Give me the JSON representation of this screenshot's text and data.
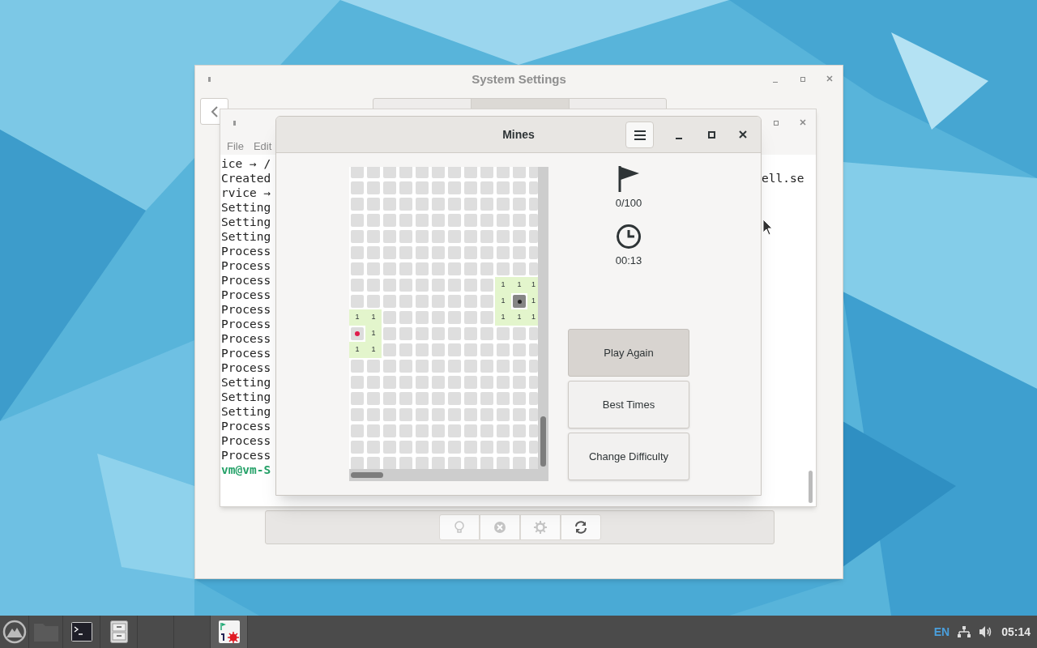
{
  "settings_window": {
    "title": "System Settings",
    "toolbar": [
      {
        "kind": "bulb",
        "disabled": true
      },
      {
        "kind": "cancel",
        "disabled": true
      },
      {
        "kind": "gear",
        "disabled": true
      },
      {
        "kind": "refresh",
        "disabled": false
      }
    ]
  },
  "terminal_window": {
    "menu": [
      "File",
      "Edit"
    ],
    "lines": [
      {
        "text": "ice → /",
        "kind": "output"
      },
      {
        "text": "Created",
        "kind": "output"
      },
      {
        "text": "rvice →",
        "kind": "output"
      },
      {
        "text": "Setting",
        "kind": "output"
      },
      {
        "text": "Setting",
        "kind": "output"
      },
      {
        "text": "Setting",
        "kind": "output"
      },
      {
        "text": "Process",
        "kind": "output"
      },
      {
        "text": "Process",
        "kind": "output"
      },
      {
        "text": "Process",
        "kind": "output"
      },
      {
        "text": "Process",
        "kind": "output"
      },
      {
        "text": "Process",
        "kind": "output"
      },
      {
        "text": "Process",
        "kind": "output"
      },
      {
        "text": "Process",
        "kind": "output"
      },
      {
        "text": "Process",
        "kind": "output"
      },
      {
        "text": "Process",
        "kind": "output"
      },
      {
        "text": "Setting",
        "kind": "output"
      },
      {
        "text": "Setting",
        "kind": "output"
      },
      {
        "text": "Setting",
        "kind": "output"
      },
      {
        "text": "Process",
        "kind": "output"
      },
      {
        "text": "Process",
        "kind": "output"
      },
      {
        "text": "Process",
        "kind": "output"
      },
      {
        "text": "vm@vm-S",
        "kind": "prompt"
      }
    ],
    "right_fragment": "ell.se"
  },
  "mines_window": {
    "title": "Mines",
    "flags": "0/100",
    "time": "00:13",
    "buttons": [
      {
        "label": "Play Again",
        "selected": true
      },
      {
        "label": "Best Times",
        "selected": false
      },
      {
        "label": "Change Difficulty",
        "selected": false
      }
    ],
    "board": {
      "rows": [
        {
          "cells": [
            {
              "kind": "hidden"
            },
            {
              "kind": "hidden"
            },
            {
              "kind": "hidden"
            },
            {
              "kind": "hidden"
            },
            {
              "kind": "hidden"
            },
            {
              "kind": "hidden"
            },
            {
              "kind": "hidden"
            },
            {
              "kind": "hidden"
            },
            {
              "kind": "hidden"
            },
            {
              "kind": "hidden"
            },
            {
              "kind": "hidden"
            },
            {
              "kind": "hidden"
            }
          ]
        },
        {
          "cells": [
            {
              "kind": "hidden"
            },
            {
              "kind": "hidden"
            },
            {
              "kind": "hidden"
            },
            {
              "kind": "hidden"
            },
            {
              "kind": "hidden"
            },
            {
              "kind": "hidden"
            },
            {
              "kind": "hidden"
            },
            {
              "kind": "hidden"
            },
            {
              "kind": "hidden"
            },
            {
              "kind": "hidden"
            },
            {
              "kind": "hidden"
            },
            {
              "kind": "hidden"
            }
          ]
        },
        {
          "cells": [
            {
              "kind": "hidden"
            },
            {
              "kind": "hidden"
            },
            {
              "kind": "hidden"
            },
            {
              "kind": "hidden"
            },
            {
              "kind": "hidden"
            },
            {
              "kind": "hidden"
            },
            {
              "kind": "hidden"
            },
            {
              "kind": "hidden"
            },
            {
              "kind": "hidden"
            },
            {
              "kind": "hidden"
            },
            {
              "kind": "hidden"
            },
            {
              "kind": "hidden"
            }
          ]
        },
        {
          "cells": [
            {
              "kind": "hidden"
            },
            {
              "kind": "hidden"
            },
            {
              "kind": "hidden"
            },
            {
              "kind": "hidden"
            },
            {
              "kind": "hidden"
            },
            {
              "kind": "hidden"
            },
            {
              "kind": "hidden"
            },
            {
              "kind": "hidden"
            },
            {
              "kind": "hidden"
            },
            {
              "kind": "hidden"
            },
            {
              "kind": "hidden"
            },
            {
              "kind": "hidden"
            }
          ]
        },
        {
          "cells": [
            {
              "kind": "hidden"
            },
            {
              "kind": "hidden"
            },
            {
              "kind": "hidden"
            },
            {
              "kind": "hidden"
            },
            {
              "kind": "hidden"
            },
            {
              "kind": "hidden"
            },
            {
              "kind": "hidden"
            },
            {
              "kind": "hidden"
            },
            {
              "kind": "hidden"
            },
            {
              "kind": "hidden"
            },
            {
              "kind": "hidden"
            },
            {
              "kind": "hidden"
            }
          ]
        },
        {
          "cells": [
            {
              "kind": "hidden"
            },
            {
              "kind": "hidden"
            },
            {
              "kind": "hidden"
            },
            {
              "kind": "hidden"
            },
            {
              "kind": "hidden"
            },
            {
              "kind": "hidden"
            },
            {
              "kind": "hidden"
            },
            {
              "kind": "hidden"
            },
            {
              "kind": "hidden"
            },
            {
              "kind": "hidden"
            },
            {
              "kind": "hidden"
            },
            {
              "kind": "hidden"
            }
          ]
        },
        {
          "cells": [
            {
              "kind": "hidden"
            },
            {
              "kind": "hidden"
            },
            {
              "kind": "hidden"
            },
            {
              "kind": "hidden"
            },
            {
              "kind": "hidden"
            },
            {
              "kind": "hidden"
            },
            {
              "kind": "hidden"
            },
            {
              "kind": "hidden"
            },
            {
              "kind": "hidden"
            },
            {
              "kind": "hidden"
            },
            {
              "kind": "hidden"
            },
            {
              "kind": "hidden"
            }
          ]
        },
        {
          "cells": [
            {
              "kind": "hidden"
            },
            {
              "kind": "hidden"
            },
            {
              "kind": "hidden"
            },
            {
              "kind": "hidden"
            },
            {
              "kind": "hidden"
            },
            {
              "kind": "hidden"
            },
            {
              "kind": "hidden"
            },
            {
              "kind": "hidden"
            },
            {
              "kind": "hidden"
            },
            {
              "kind": "number",
              "label": "1"
            },
            {
              "kind": "number",
              "label": "1"
            },
            {
              "kind": "number",
              "label": "1"
            }
          ]
        },
        {
          "cells": [
            {
              "kind": "hidden"
            },
            {
              "kind": "hidden"
            },
            {
              "kind": "hidden"
            },
            {
              "kind": "hidden"
            },
            {
              "kind": "hidden"
            },
            {
              "kind": "hidden"
            },
            {
              "kind": "hidden"
            },
            {
              "kind": "hidden"
            },
            {
              "kind": "hidden"
            },
            {
              "kind": "number",
              "label": "1"
            },
            {
              "kind": "exploded"
            },
            {
              "kind": "number",
              "label": "1"
            }
          ]
        },
        {
          "cells": [
            {
              "kind": "number",
              "label": "1"
            },
            {
              "kind": "number",
              "label": "1"
            },
            {
              "kind": "hidden"
            },
            {
              "kind": "hidden"
            },
            {
              "kind": "hidden"
            },
            {
              "kind": "hidden"
            },
            {
              "kind": "hidden"
            },
            {
              "kind": "hidden"
            },
            {
              "kind": "hidden"
            },
            {
              "kind": "number",
              "label": "1"
            },
            {
              "kind": "number",
              "label": "1"
            },
            {
              "kind": "number",
              "label": "1"
            }
          ]
        },
        {
          "cells": [
            {
              "kind": "mine"
            },
            {
              "kind": "number",
              "label": "1"
            },
            {
              "kind": "hidden"
            },
            {
              "kind": "hidden"
            },
            {
              "kind": "hidden"
            },
            {
              "kind": "hidden"
            },
            {
              "kind": "hidden"
            },
            {
              "kind": "hidden"
            },
            {
              "kind": "hidden"
            },
            {
              "kind": "hidden"
            },
            {
              "kind": "hidden"
            },
            {
              "kind": "hidden"
            }
          ]
        },
        {
          "cells": [
            {
              "kind": "number",
              "label": "1"
            },
            {
              "kind": "number",
              "label": "1"
            },
            {
              "kind": "hidden"
            },
            {
              "kind": "hidden"
            },
            {
              "kind": "hidden"
            },
            {
              "kind": "hidden"
            },
            {
              "kind": "hidden"
            },
            {
              "kind": "hidden"
            },
            {
              "kind": "hidden"
            },
            {
              "kind": "hidden"
            },
            {
              "kind": "hidden"
            },
            {
              "kind": "hidden"
            }
          ]
        },
        {
          "cells": [
            {
              "kind": "hidden"
            },
            {
              "kind": "hidden"
            },
            {
              "kind": "hidden"
            },
            {
              "kind": "hidden"
            },
            {
              "kind": "hidden"
            },
            {
              "kind": "hidden"
            },
            {
              "kind": "hidden"
            },
            {
              "kind": "hidden"
            },
            {
              "kind": "hidden"
            },
            {
              "kind": "hidden"
            },
            {
              "kind": "hidden"
            },
            {
              "kind": "hidden"
            }
          ]
        },
        {
          "cells": [
            {
              "kind": "hidden"
            },
            {
              "kind": "hidden"
            },
            {
              "kind": "hidden"
            },
            {
              "kind": "hidden"
            },
            {
              "kind": "hidden"
            },
            {
              "kind": "hidden"
            },
            {
              "kind": "hidden"
            },
            {
              "kind": "hidden"
            },
            {
              "kind": "hidden"
            },
            {
              "kind": "hidden"
            },
            {
              "kind": "hidden"
            },
            {
              "kind": "hidden"
            }
          ]
        },
        {
          "cells": [
            {
              "kind": "hidden"
            },
            {
              "kind": "hidden"
            },
            {
              "kind": "hidden"
            },
            {
              "kind": "hidden"
            },
            {
              "kind": "hidden"
            },
            {
              "kind": "hidden"
            },
            {
              "kind": "hidden"
            },
            {
              "kind": "hidden"
            },
            {
              "kind": "hidden"
            },
            {
              "kind": "hidden"
            },
            {
              "kind": "hidden"
            },
            {
              "kind": "hidden"
            }
          ]
        },
        {
          "cells": [
            {
              "kind": "hidden"
            },
            {
              "kind": "hidden"
            },
            {
              "kind": "hidden"
            },
            {
              "kind": "hidden"
            },
            {
              "kind": "hidden"
            },
            {
              "kind": "hidden"
            },
            {
              "kind": "hidden"
            },
            {
              "kind": "hidden"
            },
            {
              "kind": "hidden"
            },
            {
              "kind": "hidden"
            },
            {
              "kind": "hidden"
            },
            {
              "kind": "hidden"
            }
          ]
        },
        {
          "cells": [
            {
              "kind": "hidden"
            },
            {
              "kind": "hidden"
            },
            {
              "kind": "hidden"
            },
            {
              "kind": "hidden"
            },
            {
              "kind": "hidden"
            },
            {
              "kind": "hidden"
            },
            {
              "kind": "hidden"
            },
            {
              "kind": "hidden"
            },
            {
              "kind": "hidden"
            },
            {
              "kind": "hidden"
            },
            {
              "kind": "hidden"
            },
            {
              "kind": "hidden"
            }
          ]
        },
        {
          "cells": [
            {
              "kind": "hidden"
            },
            {
              "kind": "hidden"
            },
            {
              "kind": "hidden"
            },
            {
              "kind": "hidden"
            },
            {
              "kind": "hidden"
            },
            {
              "kind": "hidden"
            },
            {
              "kind": "hidden"
            },
            {
              "kind": "hidden"
            },
            {
              "kind": "hidden"
            },
            {
              "kind": "hidden"
            },
            {
              "kind": "hidden"
            },
            {
              "kind": "hidden"
            }
          ]
        },
        {
          "cells": [
            {
              "kind": "hidden"
            },
            {
              "kind": "hidden"
            },
            {
              "kind": "hidden"
            },
            {
              "kind": "hidden"
            },
            {
              "kind": "hidden"
            },
            {
              "kind": "hidden"
            },
            {
              "kind": "hidden"
            },
            {
              "kind": "hidden"
            },
            {
              "kind": "hidden"
            },
            {
              "kind": "hidden"
            },
            {
              "kind": "hidden"
            },
            {
              "kind": "hidden"
            }
          ]
        }
      ]
    }
  },
  "taskbar": {
    "apps": [
      {
        "kind": "launcher",
        "selected": false
      },
      {
        "kind": "folder",
        "selected": false
      },
      {
        "kind": "terminal",
        "selected": false
      },
      {
        "kind": "cabinet",
        "selected": false
      },
      {
        "kind": "empty",
        "selected": false
      },
      {
        "kind": "empty",
        "selected": false
      },
      {
        "kind": "mines",
        "selected": true
      }
    ],
    "language": "EN",
    "clock": "05:14"
  }
}
